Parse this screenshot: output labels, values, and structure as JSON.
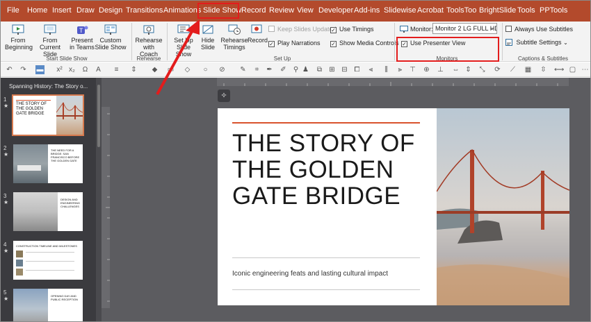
{
  "menubar": {
    "tabs": [
      "File",
      "Home",
      "Insert",
      "Draw",
      "Design",
      "Transitions",
      "Animations",
      "Slide Show",
      "Record",
      "Review",
      "View",
      "Developer",
      "Add-ins",
      "Slidewise",
      "Acrobat",
      "ToolsToo",
      "BrightSlide",
      "Tools",
      "PPTools"
    ],
    "active_tab": "Slide Show"
  },
  "ribbon": {
    "start": {
      "from_beginning": "From Beginning",
      "from_current": "From Current Slide",
      "present_teams": "Present in Teams",
      "custom_show": "Custom Slide Show",
      "group_label": "Start Slide Show"
    },
    "rehearse": {
      "rehearse_coach": "Rehearse with Coach",
      "group_label": "Rehearse"
    },
    "setup": {
      "setup_show": "Set Up Slide Show",
      "hide_slide": "Hide Slide",
      "rehearse_timings": "Rehearse Timings",
      "record": "Record",
      "keep_updated": "Keep Slides Updated",
      "play_narrations": "Play Narrations",
      "use_timings": "Use Timings",
      "show_media": "Show Media Controls",
      "group_label": "Set Up"
    },
    "monitors": {
      "monitor_label": "Monitor:",
      "monitor_value": "Monitor 2 LG FULL HD",
      "presenter_view": "Use Presenter View",
      "group_label": "Monitors"
    },
    "captions": {
      "always_subtitles": "Always Use Subtitles",
      "subtitle_settings": "Subtitle Settings",
      "group_label": "Captions & Subtitles"
    }
  },
  "left_pane": {
    "presentation_title": "Spanning History: The Story o...",
    "thumbnails": [
      {
        "number": "1",
        "star": "★",
        "title": "THE STORY OF THE GOLDEN GATE BRIDGE"
      },
      {
        "number": "2",
        "star": "★",
        "title": "THE NEED FOR A BRIDGE: SAN FRANCISCO BEFORE THE GOLDEN GATE"
      },
      {
        "number": "3",
        "star": "★",
        "title": "DESIGN AND ENGINEERING CHALLENGES"
      },
      {
        "number": "4",
        "star": "★",
        "title": "CONSTRUCTION TIMELINE AND MILESTONES"
      },
      {
        "number": "5",
        "star": "★",
        "title": "OPENING DAY AND PUBLIC RECEPTION"
      }
    ]
  },
  "slide": {
    "title": "THE STORY OF THE GOLDEN GATE BRIDGE",
    "subtitle": "Iconic engineering feats and lasting cultural impact"
  },
  "colors": {
    "menubar_bg": "#b34a2c",
    "accent_line": "#d9522c",
    "highlight_box": "#e31c1c",
    "editor_bg": "#5c5c60"
  }
}
